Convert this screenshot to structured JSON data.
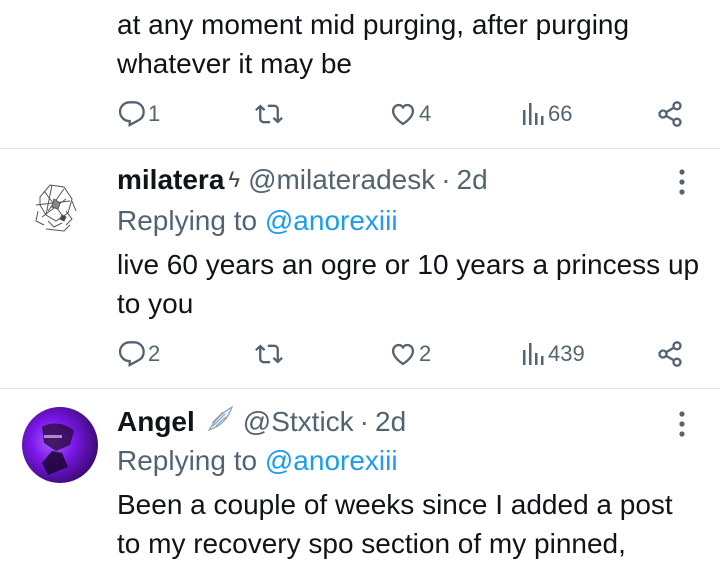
{
  "tweets": [
    {
      "body_lines": [
        "at any moment mid purging, after purging",
        "whatever it may be"
      ],
      "actions": {
        "replies": "1",
        "reposts": "",
        "likes": "4",
        "views": "66"
      }
    },
    {
      "name": "milatera",
      "name_badge": "ϟ",
      "handle": "@milateradesk",
      "separator": "·",
      "time": "2d",
      "replying_prefix": "Replying to",
      "replying_to": "@anorexiii",
      "body_lines": [
        "live 60 years an ogre or 10 years a princess up",
        "to you"
      ],
      "actions": {
        "replies": "2",
        "reposts": "",
        "likes": "2",
        "views": "439"
      }
    },
    {
      "name": "Angel",
      "name_emoji": "wing-emoji",
      "handle": "@Stxtick",
      "separator": "·",
      "time": "2d",
      "replying_prefix": "Replying to",
      "replying_to": "@anorexiii",
      "body_lines": [
        "Been a couple of weeks since I added a post",
        "to my recovery spo section of my pinned,"
      ]
    }
  ],
  "colors": {
    "text": "#0f1419",
    "secondary": "#536471",
    "link": "#1d9bf0",
    "divider": "#dfe3e6",
    "avatar_purple": "#7a17e8"
  }
}
